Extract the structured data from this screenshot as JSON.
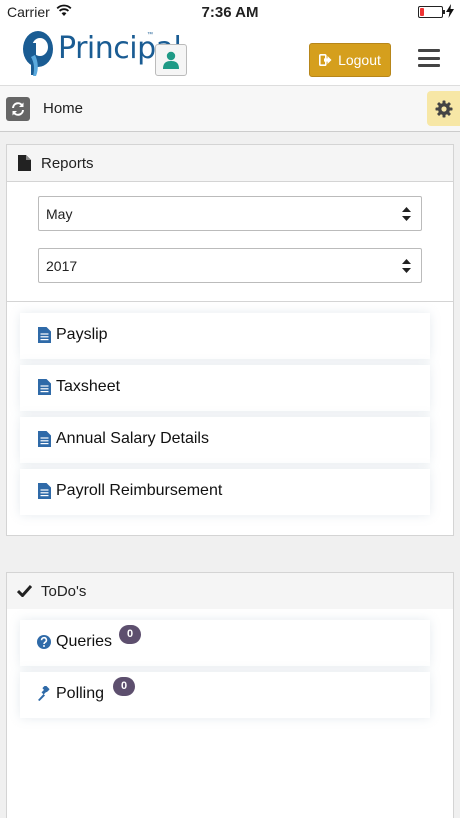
{
  "status_bar": {
    "carrier": "Carrier",
    "time": "7:36 AM"
  },
  "navbar": {
    "brand": "Principal",
    "brand_mark": "™",
    "logout_label": "Logout",
    "brand_color": "#1a5c93",
    "logout_color": "#d59f1d"
  },
  "breadcrumb": {
    "home_label": "Home"
  },
  "reports": {
    "title": "Reports",
    "month_select": {
      "value": "May"
    },
    "year_select": {
      "value": "2017"
    },
    "items": [
      {
        "label": "Payslip",
        "icon": "file-text-icon"
      },
      {
        "label": "Taxsheet",
        "icon": "file-text-icon"
      },
      {
        "label": "Annual Salary Details",
        "icon": "file-text-icon"
      },
      {
        "label": "Payroll Reimbursement",
        "icon": "file-text-icon"
      }
    ]
  },
  "todos": {
    "title": "ToDo's",
    "items": [
      {
        "label": "Queries",
        "count": "0",
        "icon": "question-circle-icon"
      },
      {
        "label": "Polling",
        "count": "0",
        "icon": "gavel-icon"
      }
    ]
  }
}
